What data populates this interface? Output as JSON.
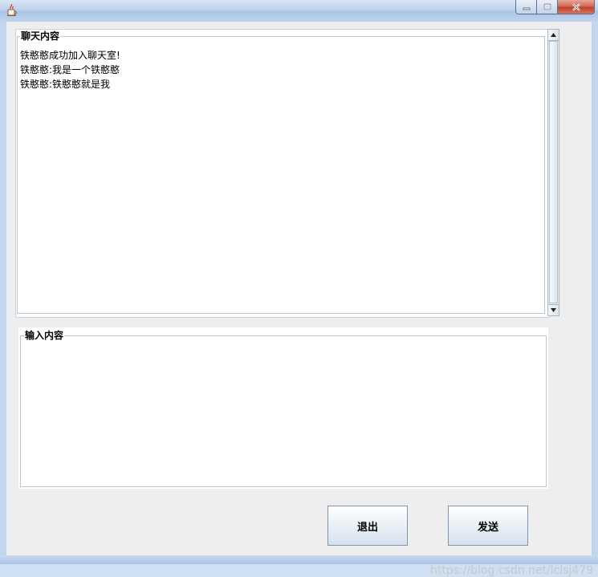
{
  "window": {
    "title": "",
    "icon": "java-cup-icon",
    "controls": [
      "minimize-icon",
      "maximize-icon",
      "close-icon"
    ]
  },
  "chat": {
    "legend": "聊天内容",
    "messages": [
      "铁憨憨成功加入聊天室!",
      "铁憨憨:我是一个铁憨憨",
      "铁憨憨:铁憨憨就是我"
    ]
  },
  "input": {
    "legend": "输入内容",
    "value": ""
  },
  "buttons": {
    "exit": "退出",
    "send": "发送"
  },
  "watermark": "https://blog.csdn.net/lclsj479",
  "colors": {
    "client_bg": "#eeeeee",
    "title_bar": "#bcd2ec",
    "close_button": "#c2412b"
  }
}
